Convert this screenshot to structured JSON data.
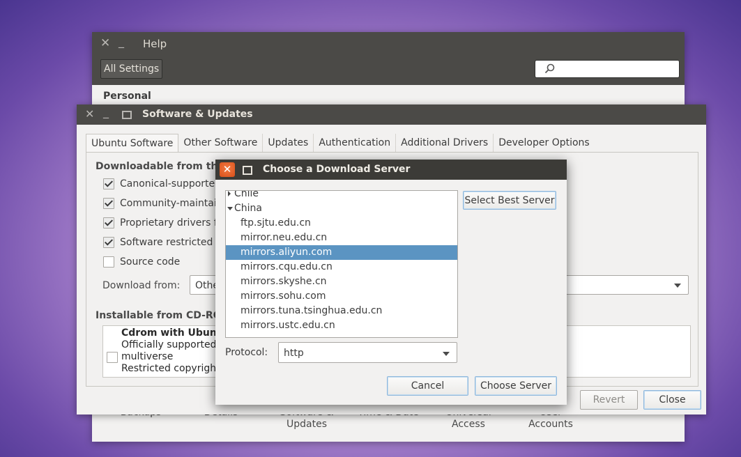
{
  "settings_window": {
    "title": "Help",
    "all_settings_label": "All Settings",
    "search_placeholder": "",
    "personal_label": "Personal",
    "bottom_items": [
      {
        "label": "Backups"
      },
      {
        "label": "Details"
      },
      {
        "label": "Software &\nUpdates"
      },
      {
        "label": "Time & Date"
      },
      {
        "label": "Universal\nAccess"
      },
      {
        "label": "User\nAccounts"
      }
    ]
  },
  "software_updates": {
    "title": "Software & Updates",
    "tabs": [
      {
        "label": "Ubuntu Software",
        "active": true
      },
      {
        "label": "Other Software"
      },
      {
        "label": "Updates"
      },
      {
        "label": "Authentication"
      },
      {
        "label": "Additional Drivers"
      },
      {
        "label": "Developer Options"
      }
    ],
    "downloadable_title": "Downloadable from the",
    "checkboxes": [
      {
        "label": "Canonical-supported",
        "checked": true
      },
      {
        "label": "Community-maintain",
        "checked": true
      },
      {
        "label": "Proprietary drivers f",
        "checked": true
      },
      {
        "label": "Software restricted b",
        "checked": true
      },
      {
        "label": "Source code",
        "checked": false
      }
    ],
    "download_from_label": "Download from:",
    "download_from_value": "Othe",
    "cdrom_title": "Installable from CD-ROM",
    "cdrom_name": "Cdrom with Ubuntu",
    "cdrom_line1": "Officially supported",
    "cdrom_line2": "multiverse",
    "cdrom_line3": "Restricted copyright",
    "revert_label": "Revert",
    "close_label": "Close"
  },
  "dialog": {
    "title": "Choose a Download Server",
    "close_glyph": "✕",
    "countries": [
      {
        "label": "Chile",
        "expanded": false
      },
      {
        "label": "China",
        "expanded": true
      }
    ],
    "servers": [
      "ftp.sjtu.edu.cn",
      "mirror.neu.edu.cn",
      "mirrors.aliyun.com",
      "mirrors.cqu.edu.cn",
      "mirrors.skyshe.cn",
      "mirrors.sohu.com",
      "mirrors.tuna.tsinghua.edu.cn",
      "mirrors.ustc.edu.cn"
    ],
    "selected_server": "mirrors.aliyun.com",
    "select_best_label": "Select Best Server",
    "protocol_label": "Protocol:",
    "protocol_value": "http",
    "cancel_label": "Cancel",
    "choose_label": "Choose Server"
  },
  "colors": {
    "titlebar": "#4b4a47",
    "selection": "#5b94c2",
    "close_orange": "#e9611e"
  }
}
